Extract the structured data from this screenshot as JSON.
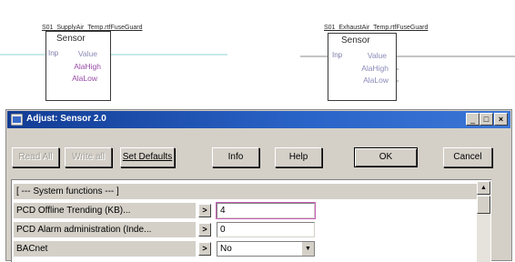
{
  "diagram": {
    "blocks": [
      {
        "title": "S01_SupplyAir_Temp.rtfFuseGuard",
        "name": "Sensor",
        "input": "Inp",
        "outputs": [
          "Value",
          "AlaHigh",
          "AlaLow"
        ]
      },
      {
        "title": "S01_ExhaustAir_Temp.rtfFuseGuard",
        "name": "Sensor",
        "input": "Inp",
        "outputs": [
          "Value",
          "AlaHigh",
          "AlaLow"
        ]
      }
    ],
    "colors": {
      "signal_line": "#8fd6cf",
      "alarm_text": "#9a4aa8"
    }
  },
  "dialog": {
    "title": "Adjust: Sensor 2.0",
    "window_buttons": {
      "minimize": "_",
      "maximize": "□",
      "close": "×"
    },
    "toolbar": {
      "read_all": "Read All",
      "write_all": "Write all",
      "set_defaults": "Set Defaults",
      "info": "Info",
      "help": "Help",
      "ok": "OK",
      "cancel": "Cancel"
    },
    "grid": {
      "group_header": "[ --- System functions --- ]",
      "rows": [
        {
          "label": "PCD Offline Trending (KB)...",
          "arrow": ">",
          "value": "4"
        },
        {
          "label": "PCD Alarm administration (Inde...",
          "arrow": ">",
          "value": "0"
        },
        {
          "label": "BACnet",
          "arrow": ">",
          "value": "No"
        }
      ]
    },
    "colors": {
      "title_bar": "#2a64c8",
      "focus_outline": "#c65fb8"
    }
  }
}
